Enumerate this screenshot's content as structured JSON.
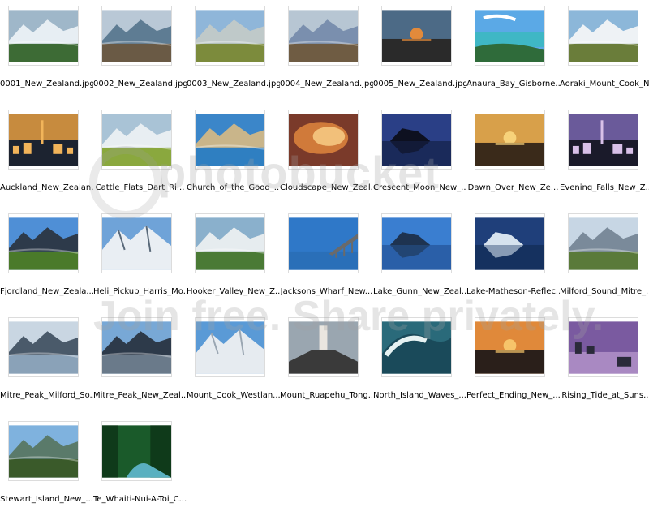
{
  "window": {
    "view": "thumbnails"
  },
  "files": [
    {
      "name": "0001_New_Zealand.jpg",
      "scene": "mountain-valley",
      "sky": "#9fb7c9",
      "ground": "#3d6b35",
      "accent": "#e7eef3"
    },
    {
      "name": "0002_New_Zealand.jpg",
      "scene": "lake-mountains",
      "sky": "#b9c8d6",
      "ground": "#6a5a45",
      "accent": "#5e7c93"
    },
    {
      "name": "0003_New_Zealand.jpg",
      "scene": "river-grass",
      "sky": "#8fb6d9",
      "ground": "#7c8b3c",
      "accent": "#bfc9c9"
    },
    {
      "name": "0004_New_Zealand.jpg",
      "scene": "lake-sunset",
      "sky": "#b7c6d3",
      "ground": "#6f5c43",
      "accent": "#7a8fae"
    },
    {
      "name": "0005_New_Zealand.jpg",
      "scene": "sunset-clouds",
      "sky": "#4c6a86",
      "ground": "#2a2a2a",
      "accent": "#e28a3b"
    },
    {
      "name": "Anaura_Bay_Gisborne...",
      "scene": "beach",
      "sky": "#5ba9e6",
      "ground": "#2f6b3a",
      "accent": "#3fb7c5"
    },
    {
      "name": "Aoraki_Mount_Cook_N...",
      "scene": "mountain-path",
      "sky": "#8cb7d9",
      "ground": "#6a7d3a",
      "accent": "#eef2f5"
    },
    {
      "name": "Auckland_New_Zealan...",
      "scene": "city-sunset",
      "sky": "#c78b3e",
      "ground": "#1c2330",
      "accent": "#f2b45a"
    },
    {
      "name": "Cattle_Flats_Dart_Ri...",
      "scene": "green-valley",
      "sky": "#a9c3d6",
      "ground": "#8aa83e",
      "accent": "#e8eef2"
    },
    {
      "name": "Church_of_the_Good_...",
      "scene": "lake-church",
      "sky": "#3b86c9",
      "ground": "#2f7fc1",
      "accent": "#c9b58a"
    },
    {
      "name": "Cloudscape_New_Zeal...",
      "scene": "cloudscape",
      "sky": "#d07a3a",
      "ground": "#7a3a2a",
      "accent": "#f2c07a"
    },
    {
      "name": "Crescent_Moon_New_...",
      "scene": "night-rock",
      "sky": "#2a3f86",
      "ground": "#1a2a5a",
      "accent": "#0d1020"
    },
    {
      "name": "Dawn_Over_New_Ze...",
      "scene": "dawn",
      "sky": "#d8a04a",
      "ground": "#3a2a1a",
      "accent": "#f7d27a"
    },
    {
      "name": "Evening_Falls_New_Z...",
      "scene": "city-night",
      "sky": "#6a5a9a",
      "ground": "#1a1a2a",
      "accent": "#d8c0e8"
    },
    {
      "name": "Fjordland_New_Zeala...",
      "scene": "fjord",
      "sky": "#4f8fd6",
      "ground": "#4a7a2a",
      "accent": "#2d3a4a"
    },
    {
      "name": "Heli_Pickup_Harris_Mo...",
      "scene": "snow-peaks",
      "sky": "#6fa3d8",
      "ground": "#e9eef3",
      "accent": "#5a6a7a"
    },
    {
      "name": "Hooker_Valley_New_Z...",
      "scene": "valley-road",
      "sky": "#8ab0cc",
      "ground": "#4a7a35",
      "accent": "#e6ecef"
    },
    {
      "name": "Jacksons_Wharf_New...",
      "scene": "wharf",
      "sky": "#2f78c8",
      "ground": "#2a6fb8",
      "accent": "#6a6a6a"
    },
    {
      "name": "Lake_Gunn_New_Zeal...",
      "scene": "lake-reflection",
      "sky": "#3a7ed0",
      "ground": "#2a5fa8",
      "accent": "#1e3350"
    },
    {
      "name": "Lake-Matheson-Reflec...",
      "scene": "reflection",
      "sky": "#1f3f7a",
      "ground": "#15315f",
      "accent": "#d6e2ee"
    },
    {
      "name": "Milford_Sound_Mitre_...",
      "scene": "grass-peak",
      "sky": "#c7d6e4",
      "ground": "#5a7a3a",
      "accent": "#7a8a9a"
    },
    {
      "name": "Mitre_Peak_Milford_So...",
      "scene": "mitre-reflection",
      "sky": "#c9d6e2",
      "ground": "#8aa2b8",
      "accent": "#4a5a6a"
    },
    {
      "name": "Mitre_Peak_New_Zeal...",
      "scene": "mitre-peak",
      "sky": "#78a8d6",
      "ground": "#6a7a8a",
      "accent": "#2d3a4a"
    },
    {
      "name": "Mount_Cook_Westlan...",
      "scene": "glacier",
      "sky": "#5a9ad6",
      "ground": "#e6ebf0",
      "accent": "#9aa6b2"
    },
    {
      "name": "Mount_Ruapehu_Tong...",
      "scene": "volcano",
      "sky": "#9aa6b0",
      "ground": "#3a3a3a",
      "accent": "#eae6e0"
    },
    {
      "name": "North_Island_Waves_...",
      "scene": "wave",
      "sky": "#2a6a7a",
      "ground": "#1a4a5a",
      "accent": "#e6f2f2"
    },
    {
      "name": "Perfect_Ending_New_...",
      "scene": "sunset-sea",
      "sky": "#e0893a",
      "ground": "#2a1f1a",
      "accent": "#f7c46a"
    },
    {
      "name": "Rising_Tide_at_Suns...",
      "scene": "rocks-dusk",
      "sky": "#7a5aa0",
      "ground": "#2a2a3a",
      "accent": "#c8a8d8"
    },
    {
      "name": "Stewart_Island_New_...",
      "scene": "island-bay",
      "sky": "#7fb2de",
      "ground": "#3a5a2a",
      "accent": "#5a7a6a"
    },
    {
      "name": "Te_Whaiti-Nui-A-Toi_C...",
      "scene": "forest-stream",
      "sky": "#1a5a2a",
      "ground": "#0f3a1a",
      "accent": "#5ab0c0"
    }
  ],
  "watermark": {
    "brand": "photobucket",
    "tagline": "Join free. Share privately."
  }
}
